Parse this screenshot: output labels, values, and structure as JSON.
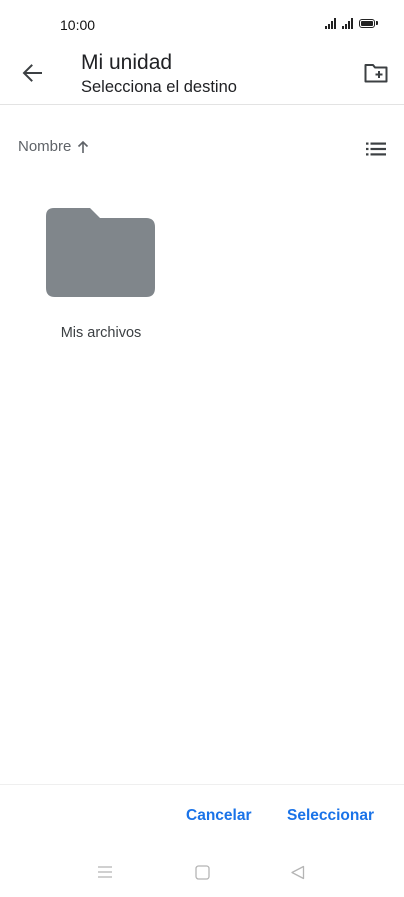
{
  "status_bar": {
    "time": "10:00",
    "icons": [
      "signal-icon",
      "signal-icon",
      "battery-icon"
    ]
  },
  "app_bar": {
    "back_icon": "arrow-back-icon",
    "title": "Mi unidad",
    "subtitle": "Selecciona el destino",
    "new_folder_icon": "create-new-folder-icon"
  },
  "sort": {
    "label": "Nombre",
    "direction_icon": "arrow-up-icon",
    "view_icon": "list-view-icon"
  },
  "folders": [
    {
      "name": "Mis archivos",
      "icon": "folder-icon",
      "color": "#80868b"
    }
  ],
  "actions": {
    "cancel_label": "Cancelar",
    "select_label": "Seleccionar",
    "accent_color": "#1a73e8"
  },
  "nav_bar": {
    "icons": [
      "menu-icon",
      "home-icon",
      "back-triangle-icon"
    ]
  }
}
